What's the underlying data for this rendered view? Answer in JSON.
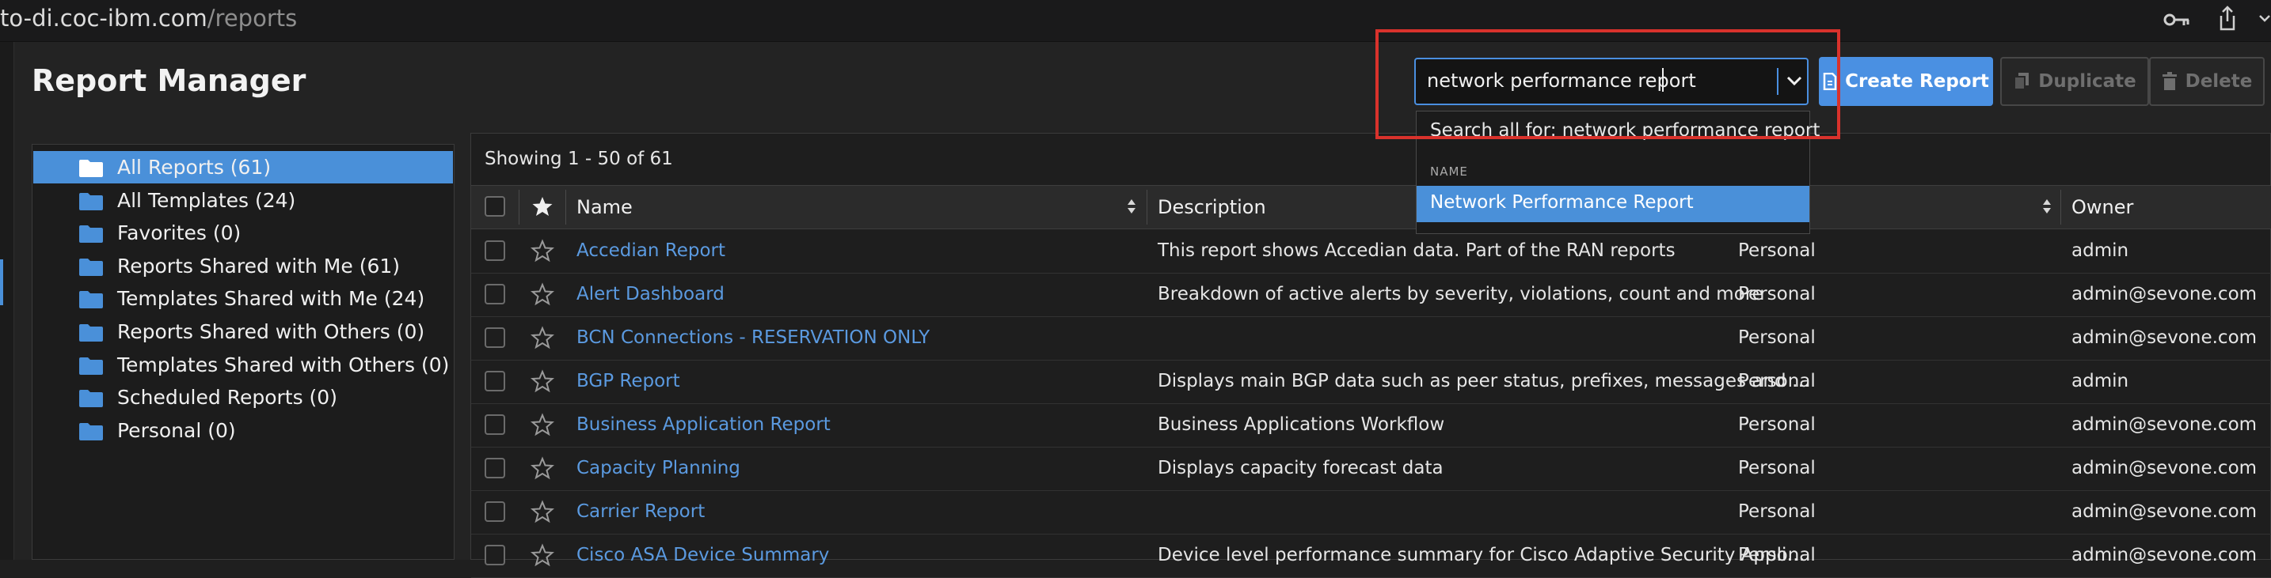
{
  "browser": {
    "url_host": "to-di.coc-ibm.com",
    "url_path": "/reports",
    "icons": [
      "key-icon",
      "share-icon",
      "chevron-down-icon"
    ]
  },
  "header": {
    "title": "Report Manager"
  },
  "search": {
    "value": "network performance report",
    "dropdown": {
      "search_all": "Search all for: network performance report",
      "group_label": "NAME",
      "option": "Network Performance Report"
    }
  },
  "toolbar": {
    "create": "Create Report",
    "duplicate": "Duplicate",
    "delete": "Delete"
  },
  "sidebar": {
    "items": [
      {
        "label": "All Reports (61)",
        "active": true
      },
      {
        "label": "All Templates (24)"
      },
      {
        "label": "Favorites (0)"
      },
      {
        "label": "Reports Shared with Me (61)"
      },
      {
        "label": "Templates Shared with Me (24)"
      },
      {
        "label": "Reports Shared with Others (0)"
      },
      {
        "label": "Templates Shared with Others (0)"
      },
      {
        "label": "Scheduled Reports (0)"
      },
      {
        "label": "Personal (0)"
      }
    ]
  },
  "table": {
    "showing": "Showing 1 - 50 of 61",
    "columns": {
      "name": "Name",
      "description": "Description",
      "owner": "Owner"
    },
    "rows": [
      {
        "name": "Accedian Report",
        "description": "This report shows Accedian data. Part of the RAN reports",
        "type": "Personal",
        "owner": "admin"
      },
      {
        "name": "Alert Dashboard",
        "description": "Breakdown of active alerts by severity, violations, count and more",
        "type": "Personal",
        "owner": "admin@sevone.com"
      },
      {
        "name": "BCN Connections - RESERVATION ONLY",
        "description": "",
        "type": "Personal",
        "owner": "admin@sevone.com"
      },
      {
        "name": "BGP Report",
        "description": "Displays main BGP data such as peer status, prefixes, messages and …",
        "type": "Personal",
        "owner": "admin"
      },
      {
        "name": "Business Application Report",
        "description": "Business Applications Workflow",
        "type": "Personal",
        "owner": "admin@sevone.com"
      },
      {
        "name": "Capacity Planning",
        "description": "Displays capacity forecast data",
        "type": "Personal",
        "owner": "admin@sevone.com"
      },
      {
        "name": "Carrier Report",
        "description": "",
        "type": "Personal",
        "owner": "admin@sevone.com"
      },
      {
        "name": "Cisco ASA Device Summary",
        "description": "Device level performance summary for Cisco Adaptive Security Appli…",
        "type": "Personal",
        "owner": "admin@sevone.com"
      }
    ]
  },
  "colors": {
    "accent": "#4a90d9",
    "link": "#5b9ae0",
    "highlight_box": "#d9322c",
    "background": "#232323"
  }
}
